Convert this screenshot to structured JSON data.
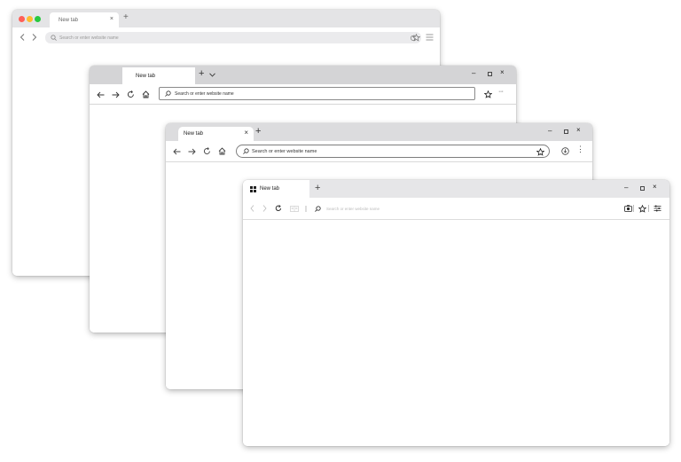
{
  "windows": [
    {
      "style": "macos",
      "tab_title": "New tab",
      "tab_close": "×",
      "new_tab": "+",
      "address_placeholder": "Search or enter website name",
      "traffic_light_colors": [
        "#ff5f57",
        "#febc2e",
        "#28c840"
      ],
      "icons": [
        "back-icon",
        "forward-icon",
        "search-icon",
        "reload-icon",
        "star-icon",
        "menu-icon"
      ]
    },
    {
      "style": "edge",
      "tab_title": "New tab",
      "new_tab": "+",
      "tab_list": "⌄",
      "address_placeholder": "Search or enter website name",
      "window_controls": [
        "–",
        "▫",
        "×"
      ],
      "more": "···",
      "icons": [
        "back-icon",
        "forward-icon",
        "reload-icon",
        "home-icon",
        "search-icon",
        "star-icon",
        "more-icon"
      ]
    },
    {
      "style": "chrome",
      "tab_title": "New tab",
      "tab_close": "×",
      "new_tab": "+",
      "address_placeholder": "Search or enter website name",
      "window_controls": [
        "–",
        "▫",
        "×"
      ],
      "more": "⋮",
      "icons": [
        "back-icon",
        "forward-icon",
        "reload-icon",
        "home-icon",
        "search-icon",
        "star-icon",
        "download-icon",
        "more-icon"
      ]
    },
    {
      "style": "firefox",
      "tab_title": "New tab",
      "new_tab": "+",
      "address_placeholder": "Search or enter website name",
      "window_controls": [
        "–",
        "▫",
        "×"
      ],
      "icons": [
        "grid-icon",
        "back-icon",
        "forward-icon",
        "reload-icon",
        "reader-icon",
        "search-icon",
        "camera-icon",
        "star-icon",
        "settings-icon"
      ]
    }
  ]
}
